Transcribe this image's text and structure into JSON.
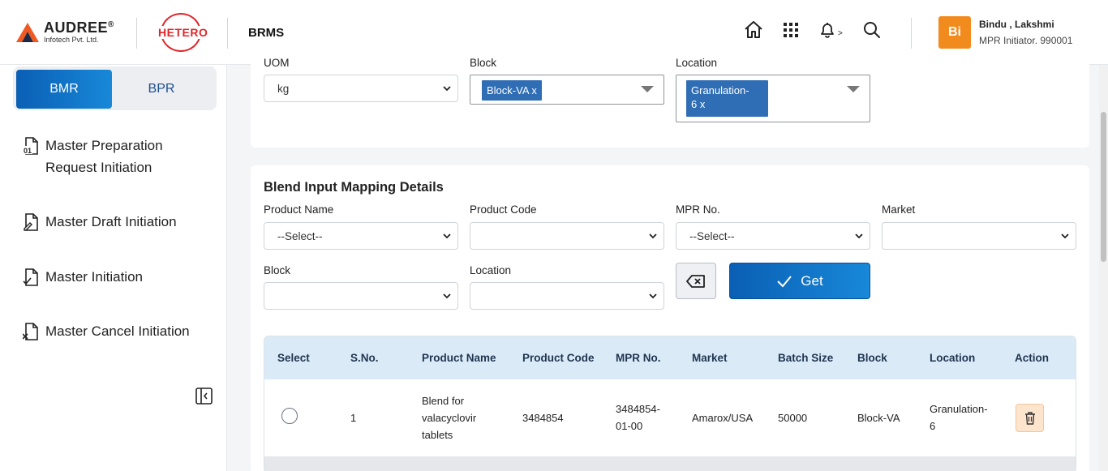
{
  "header": {
    "brand_name": "AUDREE",
    "brand_reg": "®",
    "brand_sub": "Infotech Pvt. Ltd.",
    "client_logo": "HETERO",
    "app_name": "BRMS",
    "icons": [
      "home-icon",
      "apps-grid-icon",
      "bell-icon",
      "search-icon"
    ],
    "notif_caret": ">",
    "user": {
      "initials": "Bi",
      "name": "Bindu , Lakshmi",
      "role": "MPR Initiator. 990001"
    }
  },
  "sidebar": {
    "tabs": [
      {
        "label": "BMR",
        "active": true
      },
      {
        "label": "BPR",
        "active": false
      }
    ],
    "items": [
      {
        "label_line1": "Master Preparation",
        "label_line2": "Request Initiation",
        "icon": "document-01-icon"
      },
      {
        "label": "Master Draft Initiation",
        "icon": "document-edit-icon"
      },
      {
        "label": "Master Initiation",
        "icon": "document-check-icon"
      },
      {
        "label": "Master Cancel Initiation",
        "icon": "document-cancel-icon"
      }
    ]
  },
  "top_form": {
    "uom_label": "UOM",
    "uom_value": "kg",
    "block_label": "Block",
    "block_chip": "Block-VA x",
    "location_label": "Location",
    "location_chip_line1": "Granulation-",
    "location_chip_line2": "6 x"
  },
  "blend": {
    "title": "Blend Input Mapping Details",
    "product_name_label": "Product Name",
    "product_name_value": "--Select--",
    "product_code_label": "Product Code",
    "product_code_value": "",
    "mpr_no_label": "MPR No.",
    "mpr_no_value": "--Select--",
    "market_label": "Market",
    "market_value": "",
    "block_label": "Block",
    "block_value": "",
    "location_label": "Location",
    "location_value": "",
    "get_label": "Get"
  },
  "table": {
    "columns": [
      "Select",
      "S.No.",
      "Product Name",
      "Product Code",
      "MPR No.",
      "Market",
      "Batch Size",
      "Block",
      "Location",
      "Action"
    ],
    "rows": [
      {
        "sno": "1",
        "product_name_lines": [
          "Blend for",
          "valacyclovir",
          "tablets"
        ],
        "product_code": "3484854",
        "mpr_no_lines": [
          "3484854-",
          "01-00"
        ],
        "market": "Amarox/USA",
        "batch_size": "50000",
        "block": "Block-VA",
        "location_lines": [
          "Granulation-",
          "6"
        ]
      }
    ]
  },
  "colors": {
    "primary": "#0a5fb4",
    "accent": "#1888d8",
    "avatar": "#f28b1e",
    "hetero_red": "#e0262b",
    "table_header": "#dbeaf7"
  }
}
